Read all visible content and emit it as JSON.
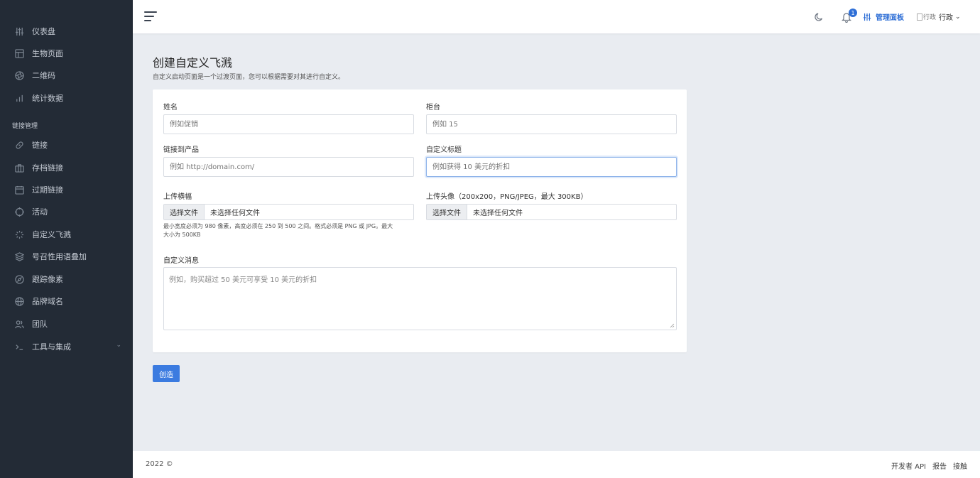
{
  "sidebar": {
    "items": [
      {
        "label": "仪表盘",
        "icon": "sliders-icon"
      },
      {
        "label": "生物页面",
        "icon": "layout-icon"
      },
      {
        "label": "二维码",
        "icon": "aperture-icon"
      },
      {
        "label": "统计数据",
        "icon": "bar-chart-icon"
      }
    ],
    "section_label": "链接管理",
    "links": [
      {
        "label": "链接",
        "icon": "link-icon"
      },
      {
        "label": "存档链接",
        "icon": "briefcase-icon"
      },
      {
        "label": "过期链接",
        "icon": "calendar-icon"
      },
      {
        "label": "活动",
        "icon": "target-icon"
      },
      {
        "label": "自定义飞溅",
        "icon": "loader-icon"
      },
      {
        "label": "号召性用语叠加",
        "icon": "layers-icon"
      },
      {
        "label": "跟踪像素",
        "icon": "compass-icon"
      },
      {
        "label": "品牌域名",
        "icon": "globe-icon"
      },
      {
        "label": "团队",
        "icon": "users-icon"
      },
      {
        "label": "工具与集成",
        "icon": "terminal-icon"
      }
    ]
  },
  "header": {
    "notification_count": "1",
    "admin_label": "管理面板",
    "avatar_alt": "行政",
    "user_name": "行政"
  },
  "page": {
    "title": "创建自定义飞溅",
    "description": "自定义启动页面是一个过渡页面，您可以根据需要对其进行自定义。"
  },
  "form": {
    "name_label": "姓名",
    "name_placeholder": "例如促销",
    "counter_label": "柜台",
    "counter_placeholder": "例如 15",
    "product_link_label": "链接到产品",
    "product_link_placeholder": "例如 http://domain.com/",
    "custom_title_label": "自定义标题",
    "custom_title_placeholder": "例如获得 10 美元的折扣",
    "banner_label": "上传横幅",
    "avatar_label": "上传头像（200x200，PNG/JPEG，最大 300KB）",
    "choose_file": "选择文件",
    "no_file": "未选择任何文件",
    "banner_hint_line1": "最小宽度必须为 980 像素，高度必须在 250 到 500 之间。格式必须是 PNG 或 JPG。最大",
    "banner_hint_line2": "大小为 500KB",
    "message_label": "自定义消息",
    "message_placeholder": "例如，购买超过 50 美元可享受 10 美元的折扣",
    "submit": "创造"
  },
  "footer": {
    "copyright": "2022 ©",
    "links": [
      "开发者 API",
      "报告",
      "接触"
    ]
  }
}
